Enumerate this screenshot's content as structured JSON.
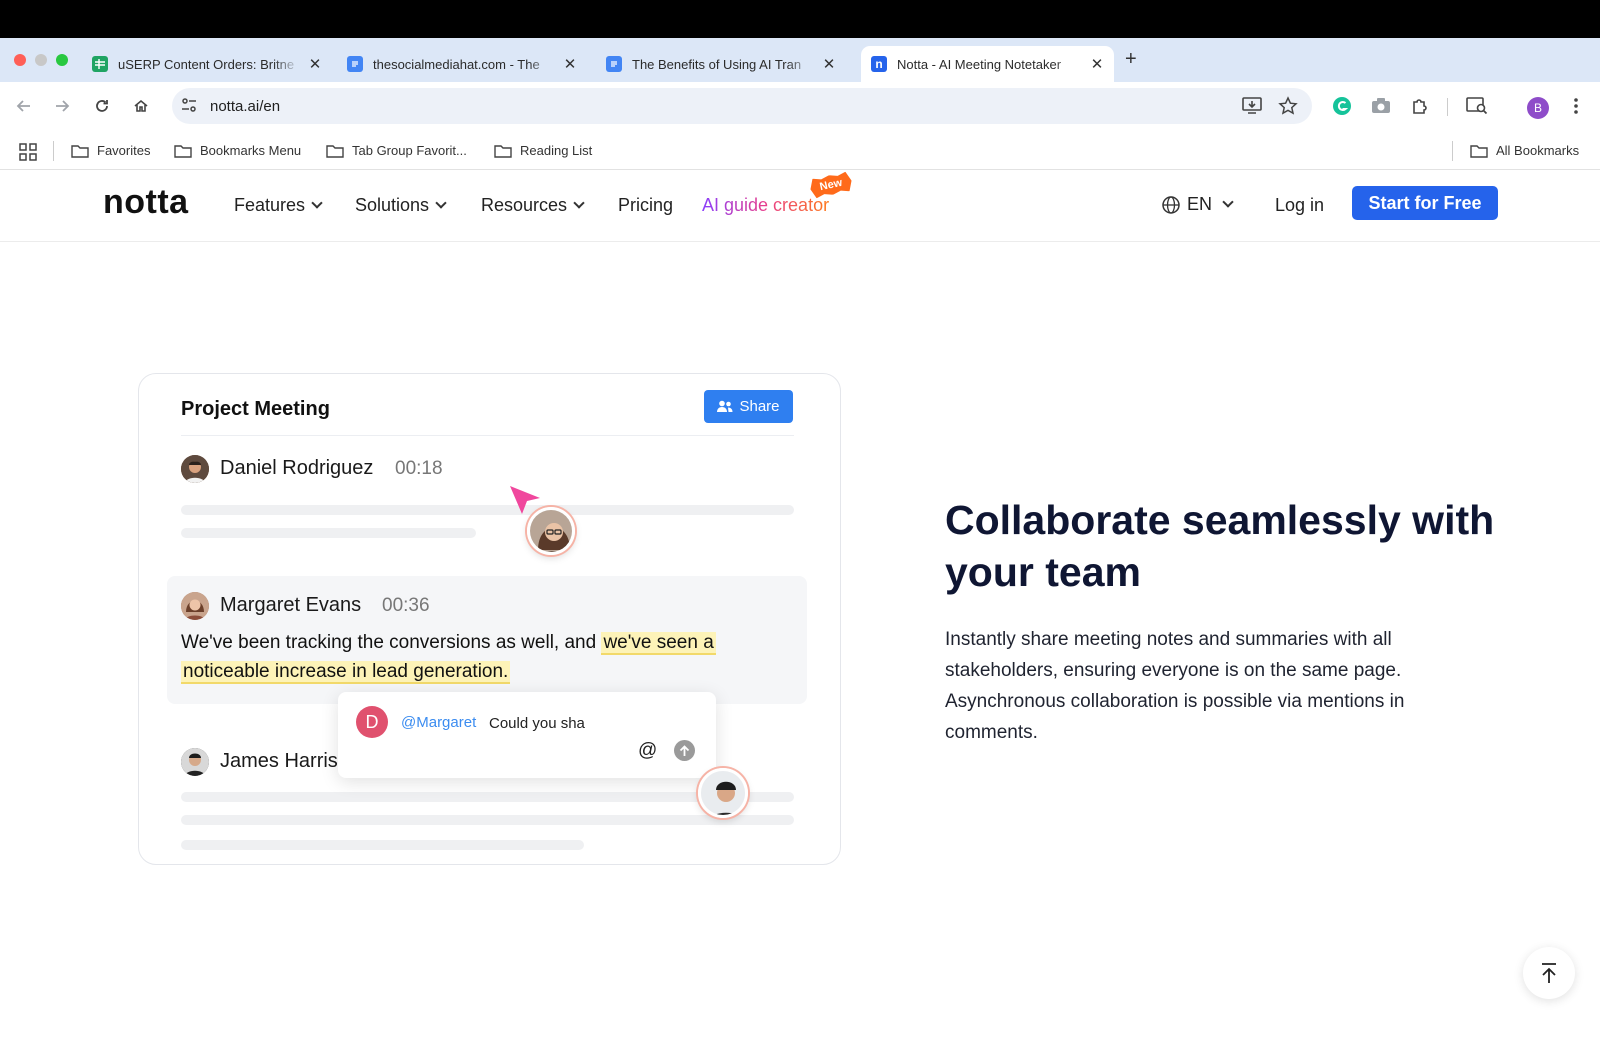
{
  "browser": {
    "tabs": [
      {
        "title": "uSERP Content Orders: Britne",
        "favicon": "sheets-icon",
        "color": "#1fa463"
      },
      {
        "title": "thesocialmediahat.com - The",
        "favicon": "docs-icon",
        "color": "#4285f4"
      },
      {
        "title": "The Benefits of Using AI Tran",
        "favicon": "docs-icon",
        "color": "#4285f4"
      },
      {
        "title": "Notta - AI Meeting Notetaker",
        "favicon": "notta-icon",
        "color": "#2563eb"
      }
    ],
    "active_tab_index": 3,
    "url": "notta.ai/en",
    "profile_initial": "B",
    "bookmarks": [
      "Favorites",
      "Bookmarks Menu",
      "Tab Group Favorit...",
      "Reading List"
    ],
    "all_bookmarks": "All Bookmarks"
  },
  "site": {
    "logo": "notta",
    "nav": [
      {
        "label": "Features"
      },
      {
        "label": "Solutions"
      },
      {
        "label": "Resources"
      },
      {
        "label": "Pricing"
      }
    ],
    "ai_guide": "AI guide creator",
    "new_badge": "New",
    "language": "EN",
    "login": "Log in",
    "cta": "Start for Free",
    "brand_color": "#2563eb"
  },
  "card": {
    "title": "Project Meeting",
    "share_label": "Share",
    "speakers": [
      {
        "name": "Daniel Rodriguez",
        "time": "00:18"
      },
      {
        "name": "Margaret Evans",
        "time": "00:36"
      },
      {
        "name": "James Harriso",
        "time": ""
      }
    ],
    "quote_plain": "We've been tracking the conversions as well, and ",
    "quote_highlight_1": "we've seen a",
    "quote_highlight_2": "noticeable increase in lead generation.",
    "comment": {
      "avatar_initial": "D",
      "mention": "@Margaret",
      "text": "Could you sha",
      "at_symbol": "@"
    }
  },
  "hero": {
    "headline": "Collaborate seamlessly with your team",
    "body": "Instantly share meeting notes and summaries with all stakeholders, ensuring everyone is on the same page. Asynchronous collaboration is possible via mentions in comments."
  }
}
